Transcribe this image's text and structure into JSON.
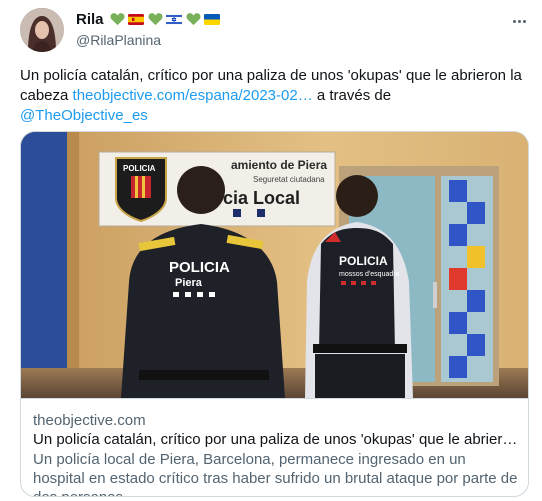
{
  "tweet": {
    "display_name": "Rila",
    "name_emojis": [
      "green-heart-icon",
      "spain-flag-icon",
      "green-heart-icon",
      "israel-flag-icon",
      "green-heart-icon",
      "ukraine-flag-icon"
    ],
    "handle": "@RilaPlanina",
    "text_part1": "Un policía catalán, crítico por una paliza de unos 'okupas' que le abrieron la cabeza ",
    "link_text": "theobjective.com/espana/2023-02…",
    "text_part2": " a través de ",
    "mention": "@TheObjective_es"
  },
  "card": {
    "image_sign_line1": "amiento de Piera",
    "image_sign_line2": "Seguretat ciutadana",
    "image_sign_line3": "cia Local",
    "image_badge_text": "POLICIA",
    "officer1_back_text1": "POLICIA",
    "officer1_back_text2": "Piera",
    "officer2_back_text1": "POLICIA",
    "officer2_back_text2": "mossos d'esquadra",
    "domain": "theobjective.com",
    "title": "Un policía catalán, crítico por una paliza de unos 'okupas' que le abrieron la c...",
    "description": "Un policía local de Piera, Barcelona, permanece ingresado en un hospital en estado crítico tras haber sufrido un brutal ataque por parte de dos personas"
  },
  "colors": {
    "link": "#1d9bf0",
    "text": "#0f1419",
    "secondary": "#536471",
    "border": "#cfd9de"
  }
}
